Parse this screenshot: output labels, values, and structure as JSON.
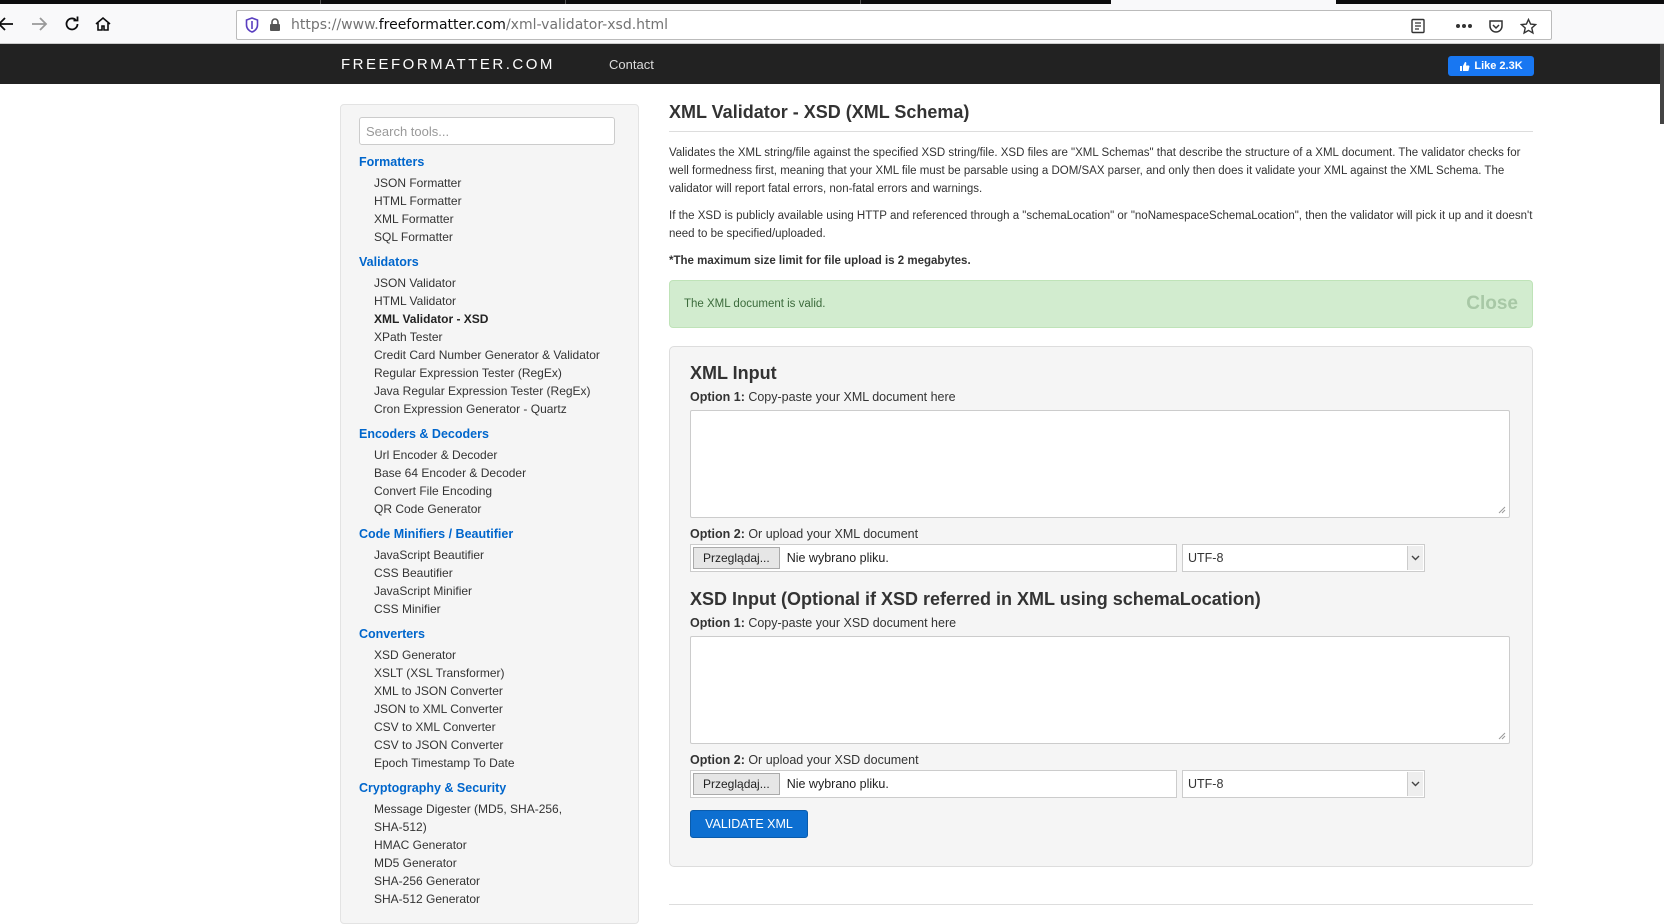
{
  "browser": {
    "url_prefix": "https://www.",
    "url_domain": "freeformatter.com",
    "url_path": "/xml-validator-xsd.html"
  },
  "site": {
    "brand": "FREEFORMATTER.COM",
    "nav_contact": "Contact",
    "fb_like": "Like 2.3K"
  },
  "sidebar": {
    "search_placeholder": "Search tools...",
    "categories": [
      {
        "title": "Formatters",
        "items": [
          "JSON Formatter",
          "HTML Formatter",
          "XML Formatter",
          "SQL Formatter"
        ]
      },
      {
        "title": "Validators",
        "items": [
          "JSON Validator",
          "HTML Validator",
          "XML Validator - XSD",
          "XPath Tester",
          "Credit Card Number Generator & Validator",
          "Regular Expression Tester (RegEx)",
          "Java Regular Expression Tester (RegEx)",
          "Cron Expression Generator - Quartz"
        ]
      },
      {
        "title": "Encoders & Decoders",
        "items": [
          "Url Encoder & Decoder",
          "Base 64 Encoder & Decoder",
          "Convert File Encoding",
          "QR Code Generator"
        ]
      },
      {
        "title": "Code Minifiers / Beautifier",
        "items": [
          "JavaScript Beautifier",
          "CSS Beautifier",
          "JavaScript Minifier",
          "CSS Minifier"
        ]
      },
      {
        "title": "Converters",
        "items": [
          "XSD Generator",
          "XSLT (XSL Transformer)",
          "XML to JSON Converter",
          "JSON to XML Converter",
          "CSV to XML Converter",
          "CSV to JSON Converter",
          "Epoch Timestamp To Date"
        ]
      },
      {
        "title": "Cryptography & Security",
        "items": [
          "Message Digester (MD5, SHA-256,",
          "SHA-512)",
          "HMAC Generator",
          "MD5 Generator",
          "SHA-256 Generator",
          "SHA-512 Generator"
        ]
      }
    ],
    "active_item": "XML Validator - XSD"
  },
  "main": {
    "title": "XML Validator - XSD (XML Schema)",
    "desc1": "Validates the XML string/file against the specified XSD string/file. XSD files are \"XML Schemas\" that describe the structure of a XML document. The validator checks for well formedness first, meaning that your XML file must be parsable using a DOM/SAX parser, and only then does it validate your XML against the XML Schema. The validator will report fatal errors, non-fatal errors and warnings.",
    "desc2": "If the XSD is publicly available using HTTP and referenced through a \"schemaLocation\" or \"noNamespaceSchemaLocation\", then the validator will pick it up and it doesn't need to be specified/uploaded.",
    "desc3": "*The maximum size limit for file upload is 2 megabytes.",
    "alert_message": "The XML document is valid.",
    "alert_close": "Close",
    "xml_section": {
      "title": "XML Input",
      "option1_prefix": "Option 1:",
      "option1_text": " Copy-paste your XML document here",
      "option2_prefix": "Option 2:",
      "option2_text": " Or upload your XML document",
      "browse_label": "Przeglądaj...",
      "no_file_label": "Nie wybrano pliku.",
      "encoding": "UTF-8"
    },
    "xsd_section": {
      "title": "XSD Input (Optional if XSD referred in XML using schemaLocation)",
      "option1_prefix": "Option 1:",
      "option1_text": " Copy-paste your XSD document here",
      "option2_prefix": "Option 2:",
      "option2_text": " Or upload your XSD document",
      "browse_label": "Przeglądaj...",
      "no_file_label": "Nie wybrano pliku.",
      "encoding": "UTF-8"
    },
    "validate_label": "VALIDATE XML"
  }
}
